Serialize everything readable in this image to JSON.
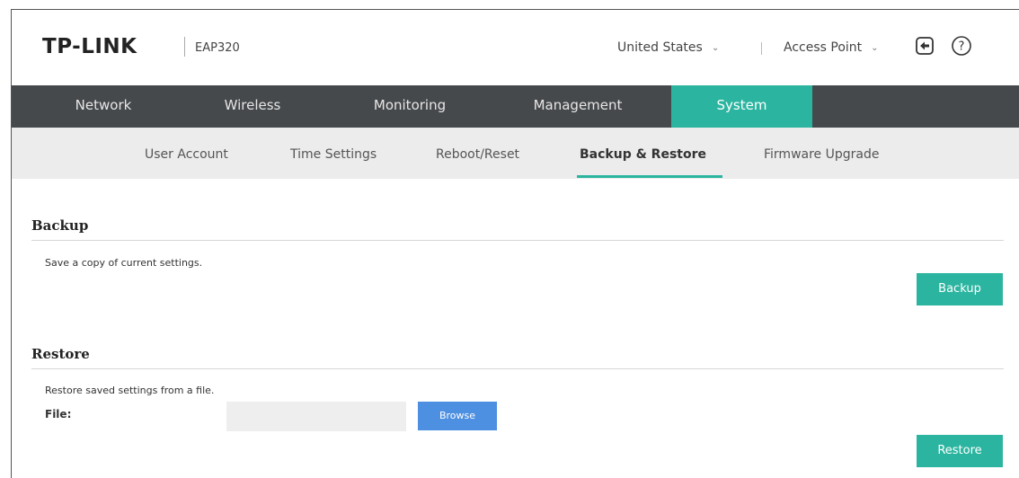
{
  "header": {
    "brand": "TP-LINK",
    "model": "EAP320",
    "region": "United States",
    "mode": "Access Point",
    "icons": [
      "logout-icon",
      "help-icon"
    ]
  },
  "main_nav": {
    "tabs": [
      {
        "label": "Network",
        "active": false
      },
      {
        "label": "Wireless",
        "active": false
      },
      {
        "label": "Monitoring",
        "active": false
      },
      {
        "label": "Management",
        "active": false
      },
      {
        "label": "System",
        "active": true
      }
    ]
  },
  "sub_nav": {
    "tabs": [
      {
        "label": "User Account",
        "active": false
      },
      {
        "label": "Time Settings",
        "active": false
      },
      {
        "label": "Reboot/Reset",
        "active": false
      },
      {
        "label": "Backup & Restore",
        "active": true
      },
      {
        "label": "Firmware Upgrade",
        "active": false
      }
    ]
  },
  "backup": {
    "title": "Backup",
    "description": "Save a copy of current settings.",
    "button_label": "Backup"
  },
  "restore": {
    "title": "Restore",
    "description": "Restore saved settings from a file.",
    "file_label": "File:",
    "file_value": "",
    "browse_label": "Browse",
    "button_label": "Restore"
  },
  "colors": {
    "accent": "#2bb5a0",
    "nav_bg": "#46494c",
    "subnav_bg": "#ececec",
    "browse": "#4d8fe0"
  }
}
